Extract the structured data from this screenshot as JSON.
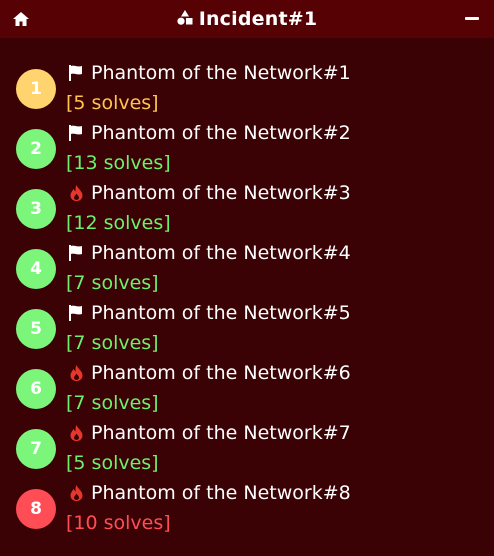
{
  "window": {
    "title": "Incident#1",
    "home_icon": "home-icon",
    "title_icon": "shapes-icon",
    "minimize_icon": "minimize-icon"
  },
  "colors": {
    "background": "#3b0205",
    "titlebar": "#560205",
    "yellow": "#ffd36e",
    "green": "#7cf67a",
    "red": "#ff4d55",
    "solves_yellow": "#ffc54d",
    "solves_green": "#6ef06c",
    "solves_red": "#ff4d55",
    "fire": "#e8372a"
  },
  "challenges": [
    {
      "rank": "1",
      "name": "Phantom of the Network#1",
      "solves": "[5 solves]",
      "icon": "flag-icon",
      "color": "yellow"
    },
    {
      "rank": "2",
      "name": "Phantom of the Network#2",
      "solves": "[13 solves]",
      "icon": "flag-icon",
      "color": "green"
    },
    {
      "rank": "3",
      "name": "Phantom of the Network#3",
      "solves": "[12 solves]",
      "icon": "fire-icon",
      "color": "green"
    },
    {
      "rank": "4",
      "name": "Phantom of the Network#4",
      "solves": "[7 solves]",
      "icon": "flag-icon",
      "color": "green"
    },
    {
      "rank": "5",
      "name": "Phantom of the Network#5",
      "solves": "[7 solves]",
      "icon": "flag-icon",
      "color": "green"
    },
    {
      "rank": "6",
      "name": "Phantom of the Network#6",
      "solves": "[7 solves]",
      "icon": "fire-icon",
      "color": "green"
    },
    {
      "rank": "7",
      "name": "Phantom of the Network#7",
      "solves": "[5 solves]",
      "icon": "fire-icon",
      "color": "green"
    },
    {
      "rank": "8",
      "name": "Phantom of the Network#8",
      "solves": "[10 solves]",
      "icon": "fire-icon",
      "color": "red"
    }
  ]
}
